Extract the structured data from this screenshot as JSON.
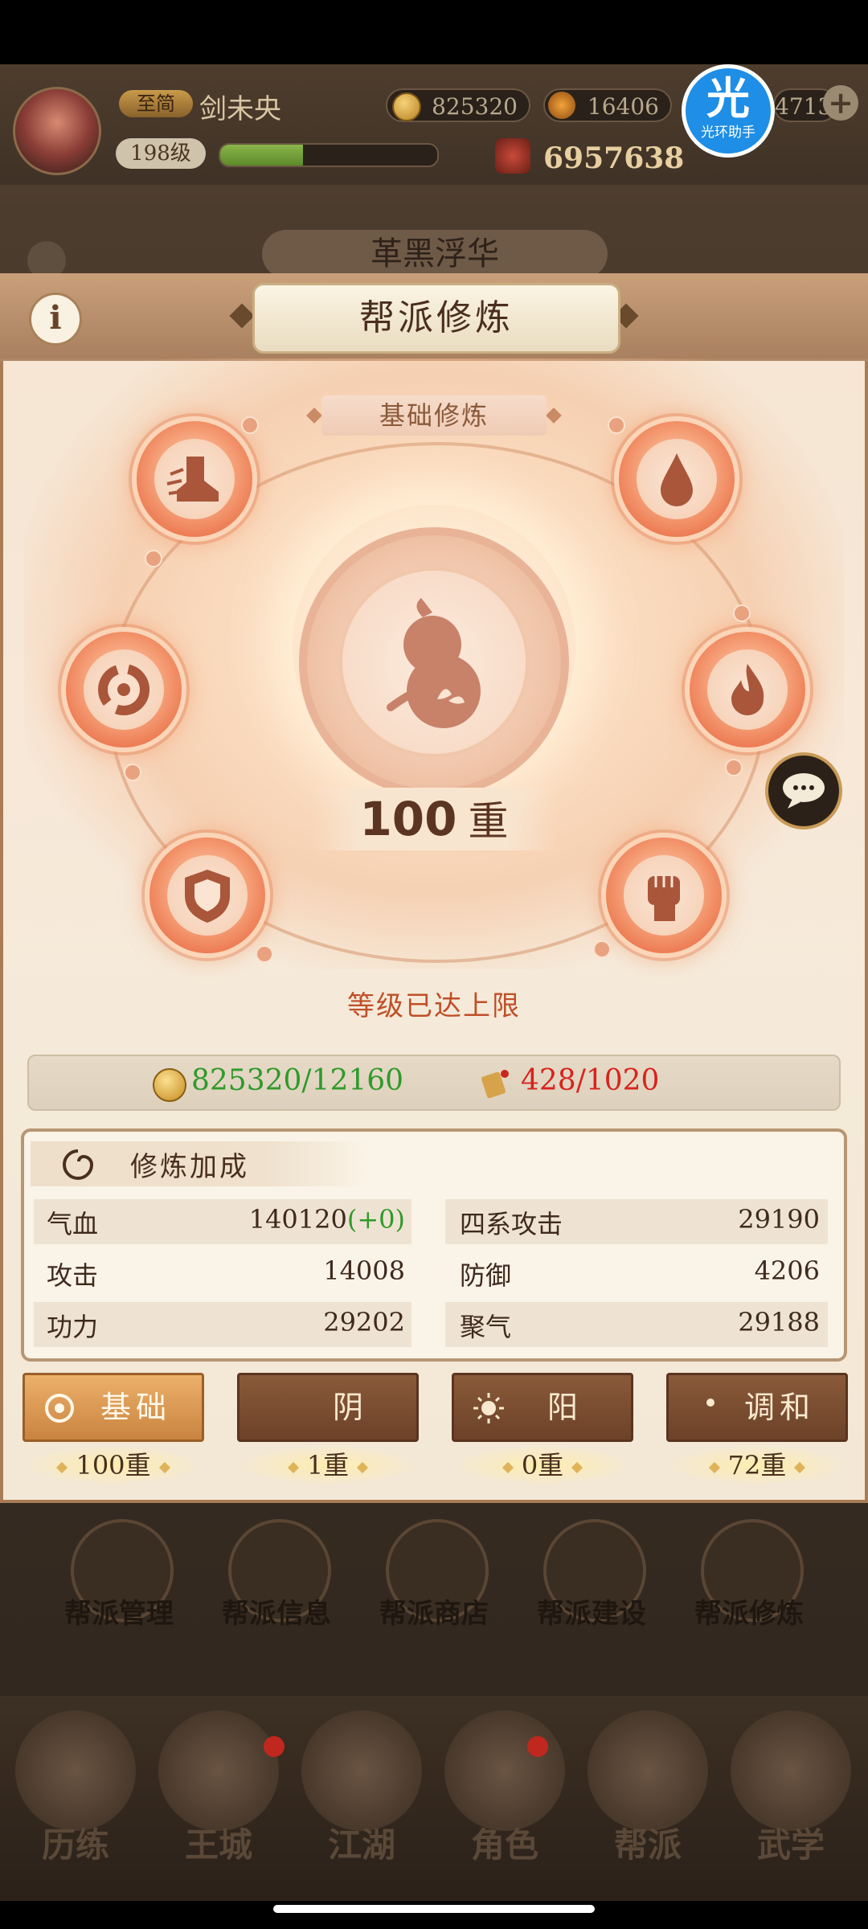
{
  "player": {
    "vip_label": "至简",
    "name": "剑未央",
    "level": "198级",
    "exp_fraction": 0.38,
    "currency_1": "825320",
    "currency_2": "16406",
    "currency_3": "4713",
    "power": "6957638"
  },
  "helper": {
    "glyph": "光",
    "label": "光环助手"
  },
  "background_title": "革黑浮华",
  "panel": {
    "title": "帮派修炼",
    "info_glyph": "i",
    "section_tab": "基础修炼",
    "level_value": "100",
    "level_unit": "重",
    "max_message": "等级已达上限"
  },
  "nodes": [
    {
      "name": "boot-icon"
    },
    {
      "name": "drop-icon"
    },
    {
      "name": "swirl-icon"
    },
    {
      "name": "flame-icon"
    },
    {
      "name": "shield-icon"
    },
    {
      "name": "fist-icon"
    }
  ],
  "cost": {
    "coins": "825320/12160",
    "scrolls": "428/1020",
    "coins_color": "#2f9a2a",
    "scrolls_color": "#d8231d"
  },
  "bonus": {
    "title": "修炼加成",
    "rows": [
      {
        "left_label": "气血",
        "left_value": "140120",
        "left_extra": "(+0)",
        "right_label": "四系攻击",
        "right_value": "29190"
      },
      {
        "left_label": "攻击",
        "left_value": "14008",
        "left_extra": "",
        "right_label": "防御",
        "right_value": "4206"
      },
      {
        "left_label": "功力",
        "left_value": "29202",
        "left_extra": "",
        "right_label": "聚气",
        "right_value": "29188"
      }
    ]
  },
  "branches": [
    {
      "label": "基础",
      "level": "100重",
      "active": true
    },
    {
      "label": "阴",
      "level": "1重",
      "active": false
    },
    {
      "label": "阳",
      "level": "0重",
      "active": false
    },
    {
      "label": "调和",
      "level": "72重",
      "active": false
    }
  ],
  "guild_menu": [
    "帮派管理",
    "帮派信息",
    "帮派商店",
    "帮派建设",
    "帮派修炼"
  ],
  "nav": [
    "历练",
    "王城",
    "江湖",
    "角色",
    "帮派",
    "武学"
  ]
}
